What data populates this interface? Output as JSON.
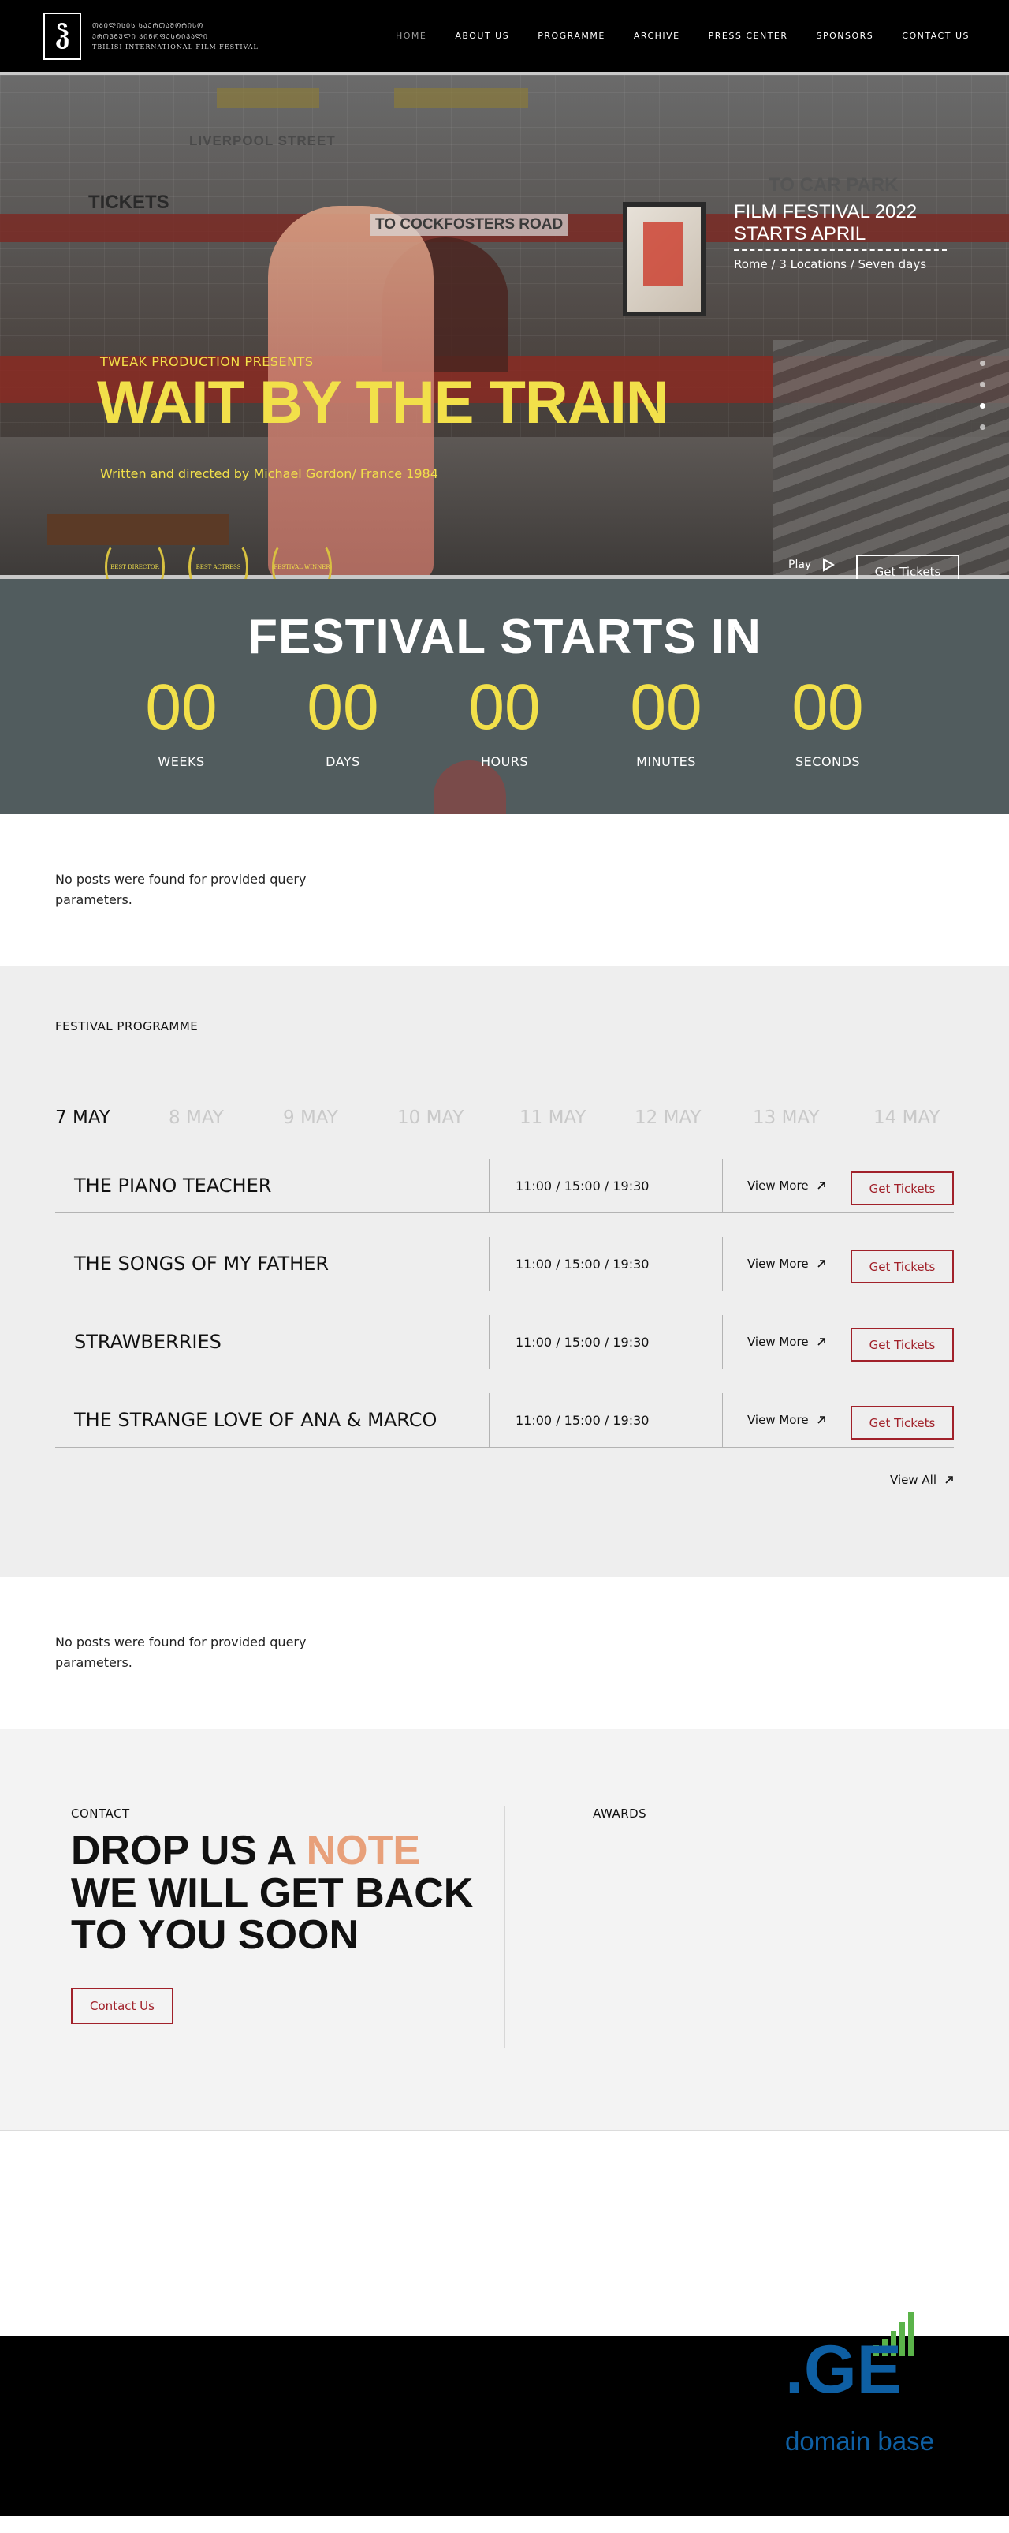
{
  "header": {
    "logo_lines": [
      "ᲗᲑᲘᲚᲘᲡᲘᲡ ᲡᲐᲔᲠᲗᲐᲨᲝᲠᲘᲡᲝ",
      "ᲔᲠᲝᲕᲜᲣᲚᲘ ᲙᲘᲜᲝᲤᲔᲡᲢᲘᲕᲐᲚᲘ",
      "TBILISI INTERNATIONAL FILM FESTIVAL"
    ],
    "logo_mark": "ჴ",
    "nav": [
      "HOME",
      "ABOUT US",
      "PROGRAMME",
      "ARCHIVE",
      "PRESS CENTER",
      "SPONSORS",
      "CONTACT US"
    ],
    "active_nav": "HOME"
  },
  "hero": {
    "signs": {
      "liverpool": "LIVERPOOL STREET",
      "tickets": "TICKETS",
      "cockfosters": "TO COCKFOSTERS ROAD",
      "carpark": "TO CAR PARK"
    },
    "presents": "TWEAK PRODUCTION PRESENTS",
    "title": "WAIT BY THE TRAIN",
    "subtitle": "Written and directed by Michael Gordon/ France 1984",
    "laurels": [
      "BEST DIRECTOR",
      "BEST ACTRESS",
      "FESTIVAL WINNER"
    ],
    "festival_title_line1": "FILM FESTIVAL 2022",
    "festival_title_line2": "STARTS APRIL",
    "festival_meta": "Rome / 3 Locations / Seven days",
    "play_label": "Play",
    "tickets_label": "Get Tickets",
    "slide_count": 4,
    "active_slide": 3
  },
  "countdown": {
    "title": "FESTIVAL STARTS IN",
    "units": [
      {
        "value": "00",
        "label": "WEEKS"
      },
      {
        "value": "00",
        "label": "DAYS"
      },
      {
        "value": "00",
        "label": "HOURS"
      },
      {
        "value": "00",
        "label": "MINUTES"
      },
      {
        "value": "00",
        "label": "SECONDS"
      }
    ]
  },
  "posts_empty_1": "No posts were found for provided query parameters.",
  "programme": {
    "heading": "FESTIVAL PROGRAMME",
    "dates": [
      "7 MAY",
      "8 MAY",
      "9 MAY",
      "10 MAY",
      "11 MAY",
      "12 MAY",
      "13 MAY",
      "14 MAY"
    ],
    "active_date": "7 MAY",
    "rows": [
      {
        "title": "THE PIANO TEACHER",
        "times": "11:00 / 15:00 / 19:30",
        "more": "View More",
        "tickets": "Get Tickets"
      },
      {
        "title": "THE SONGS OF MY FATHER",
        "times": "11:00 / 15:00 / 19:30",
        "more": "View More",
        "tickets": "Get Tickets"
      },
      {
        "title": "STRAWBERRIES",
        "times": "11:00 / 15:00 / 19:30",
        "more": "View More",
        "tickets": "Get Tickets"
      },
      {
        "title": "THE STRANGE LOVE OF ANA & MARCO",
        "times": "11:00 / 15:00 / 19:30",
        "more": "View More",
        "tickets": "Get Tickets"
      }
    ],
    "view_all": "View All"
  },
  "posts_empty_2": "No posts were found for provided query parameters.",
  "contact": {
    "label": "CONTACT",
    "head_line1_a": "DROP US A ",
    "head_line1_b": "NOTE",
    "head_line2": "WE WILL GET BACK",
    "head_line3": "TO YOU SOON",
    "button": "Contact Us",
    "awards_label": "AWARDS"
  },
  "footer": {
    "brand": ".GE",
    "brand_sub": "domain base"
  },
  "colors": {
    "accent_yellow": "#f2e04a",
    "brand_red": "#a1212a",
    "note_orange": "#e8a07a",
    "countdown_bg": "#515c5e",
    "ge_blue": "#0e5fa3",
    "ge_green": "#5bb34a"
  }
}
